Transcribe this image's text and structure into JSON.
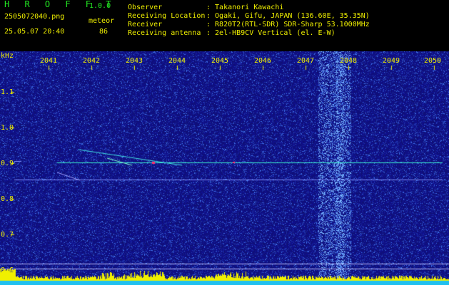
{
  "header": {
    "app_title": "H R O F F T",
    "version": "1.0.0",
    "filename": "2505072040.png",
    "mode": "meteor",
    "datetime": "25.05.07 20:40",
    "count": "86",
    "fields": [
      {
        "key": "Observer",
        "value": ": Takanori Kawachi"
      },
      {
        "key": "Receiving Location",
        "value": ": Ogaki, Gifu, JAPAN (136.60E, 35.35N)"
      },
      {
        "key": "Receiver",
        "value": ": R820T2(RTL-SDR) SDR-Sharp 53.1000MHz"
      },
      {
        "key": "Receiving antenna",
        "value": ": 2el-HB9CV Vertical (el. E-W)"
      }
    ]
  },
  "axes": {
    "y_unit": "kHz",
    "x_ticks": [
      "2041",
      "2042",
      "2043",
      "2044",
      "2045",
      "2046",
      "2047",
      "2048",
      "2049",
      "2050"
    ],
    "y_ticks": [
      "1.1",
      "1.0",
      "0.9",
      "0.8",
      "0.7",
      "0.6"
    ]
  },
  "colors": {
    "background": "#1a1a8a",
    "label_yellow": "#f0f000",
    "label_green": "#22e622",
    "carrier": "#3cf0d0",
    "histogram": "#f0f000",
    "histogram_base": "#20c0f0"
  }
}
